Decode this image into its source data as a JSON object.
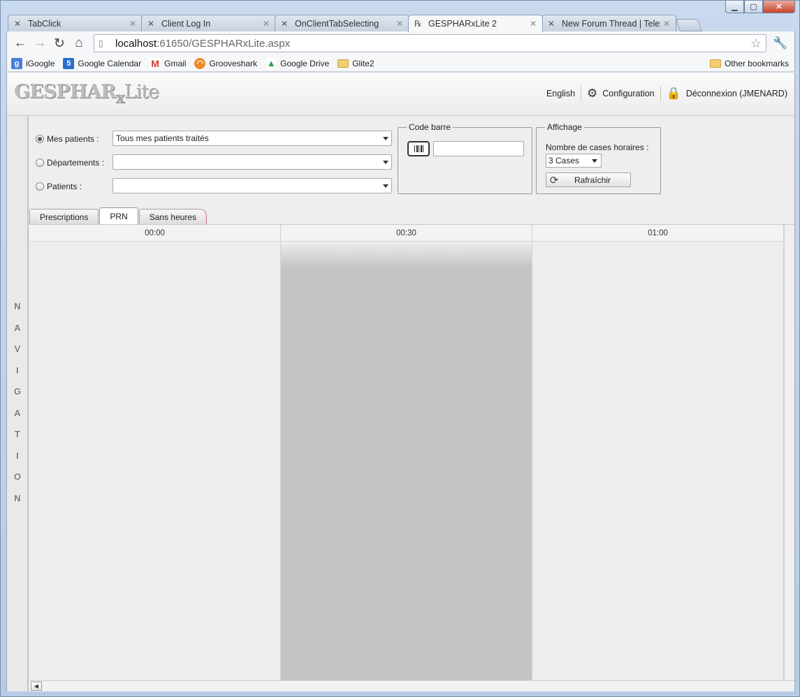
{
  "browser": {
    "tabs": [
      {
        "title": "TabClick",
        "icon": "telerik-icon"
      },
      {
        "title": "Client Log In",
        "icon": "telerik-icon"
      },
      {
        "title": "OnClientTabSelecting",
        "icon": "telerik-icon"
      },
      {
        "title": "GESPHARxLite 2",
        "icon": "gesphar-icon",
        "active": true
      },
      {
        "title": "New Forum Thread | Teleri",
        "icon": "telerik-icon"
      }
    ],
    "url_host": "localhost",
    "url_rest": ":61650/GESPHARxLite.aspx",
    "bookmarks": [
      {
        "label": "iGoogle",
        "icon": "igoogle-icon",
        "color": "#4a7fd8"
      },
      {
        "label": "Google Calendar",
        "icon": "calendar-icon",
        "color": "#2a6fd0"
      },
      {
        "label": "Gmail",
        "icon": "gmail-icon",
        "color": "#d23b2b"
      },
      {
        "label": "Grooveshark",
        "icon": "grooveshark-icon",
        "color": "#f08a24"
      },
      {
        "label": "Google Drive",
        "icon": "drive-icon",
        "color": "#2f9e4f"
      },
      {
        "label": "Glite2",
        "icon": "folder-icon"
      }
    ],
    "other_bookmarks": "Other bookmarks"
  },
  "app": {
    "logo": {
      "main": "GESPHAR",
      "x": "x",
      "lite": "Lite"
    },
    "header": {
      "language": "English",
      "configuration": "Configuration",
      "logout": "Déconnexion (JMENARD)"
    },
    "navigation_letters": [
      "N",
      "A",
      "V",
      "I",
      "G",
      "A",
      "T",
      "I",
      "O",
      "N"
    ],
    "filters": {
      "mes_patients_label": "Mes patients :",
      "mes_patients_value": "Tous mes patients traités",
      "departements_label": "Départements :",
      "departements_value": "",
      "patients_label": "Patients :",
      "patients_value": ""
    },
    "barcode": {
      "legend": "Code barre",
      "value": ""
    },
    "display": {
      "legend": "Affichage",
      "slots_label": "Nombre de cases horaires :",
      "slots_value": "3 Cases",
      "refresh_label": "Rafraîchir"
    },
    "tabs": [
      "Prescriptions",
      "PRN",
      "Sans heures"
    ],
    "active_tab": "PRN",
    "timeline": {
      "columns": [
        "00:00",
        "00:30",
        "01:00"
      ],
      "highlight_column": "00:30"
    }
  }
}
